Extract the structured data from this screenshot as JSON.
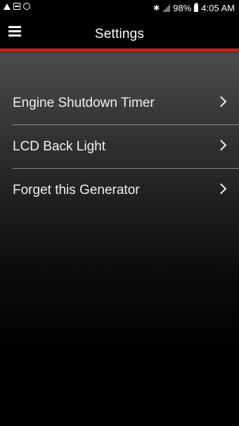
{
  "status_bar": {
    "battery": "98%",
    "time": "4:05 AM"
  },
  "header": {
    "title": "Settings"
  },
  "settings": {
    "items": [
      {
        "label": "Engine Shutdown Timer"
      },
      {
        "label": "LCD Back Light"
      },
      {
        "label": "Forget this Generator"
      }
    ]
  },
  "colors": {
    "accent": "#e2242b",
    "background": "#000000"
  }
}
